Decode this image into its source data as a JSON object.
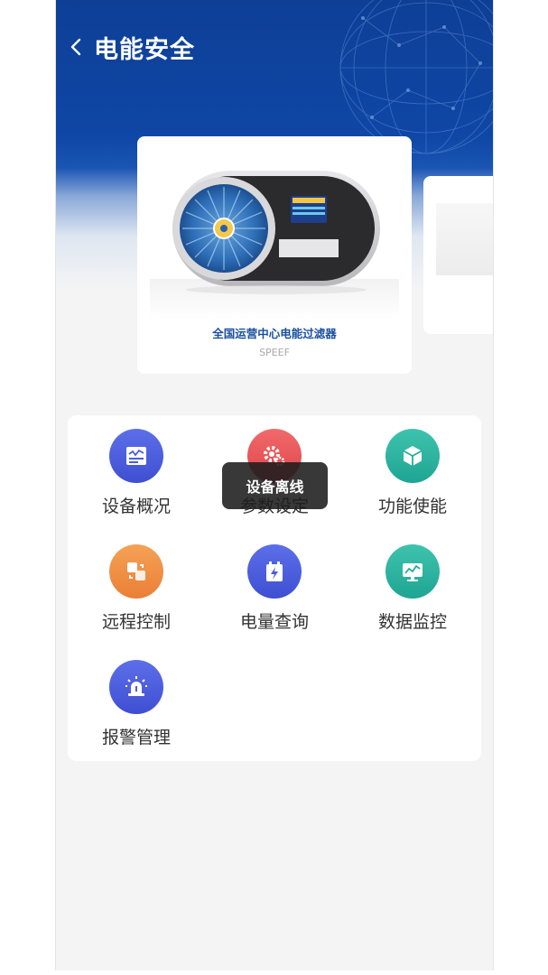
{
  "header": {
    "title": "电能安全",
    "back_icon": "chevron-left-icon"
  },
  "colors": {
    "header_blue": "#0f47a6",
    "product_title": "#1a4f9e",
    "icon_blue": "#4a5ce0",
    "icon_red": "#e8565a",
    "icon_teal": "#26ad99",
    "icon_orange": "#ef8c40"
  },
  "carousel": {
    "items": [
      {
        "title": "全国运营中心电能过滤器",
        "subtitle": "SPEEF"
      }
    ]
  },
  "menu": {
    "items": [
      {
        "label": "设备概况",
        "icon": "device-overview-icon",
        "color": "blue"
      },
      {
        "label": "参数设定",
        "icon": "settings-gear-icon",
        "color": "red"
      },
      {
        "label": "功能使能",
        "icon": "cube-icon",
        "color": "teal"
      },
      {
        "label": "远程控制",
        "icon": "remote-control-icon",
        "color": "orange"
      },
      {
        "label": "电量查询",
        "icon": "battery-charge-icon",
        "color": "blue"
      },
      {
        "label": "数据监控",
        "icon": "monitor-chart-icon",
        "color": "teal"
      },
      {
        "label": "报警管理",
        "icon": "alarm-light-icon",
        "color": "blue"
      }
    ]
  },
  "toast": {
    "message": "设备离线"
  }
}
